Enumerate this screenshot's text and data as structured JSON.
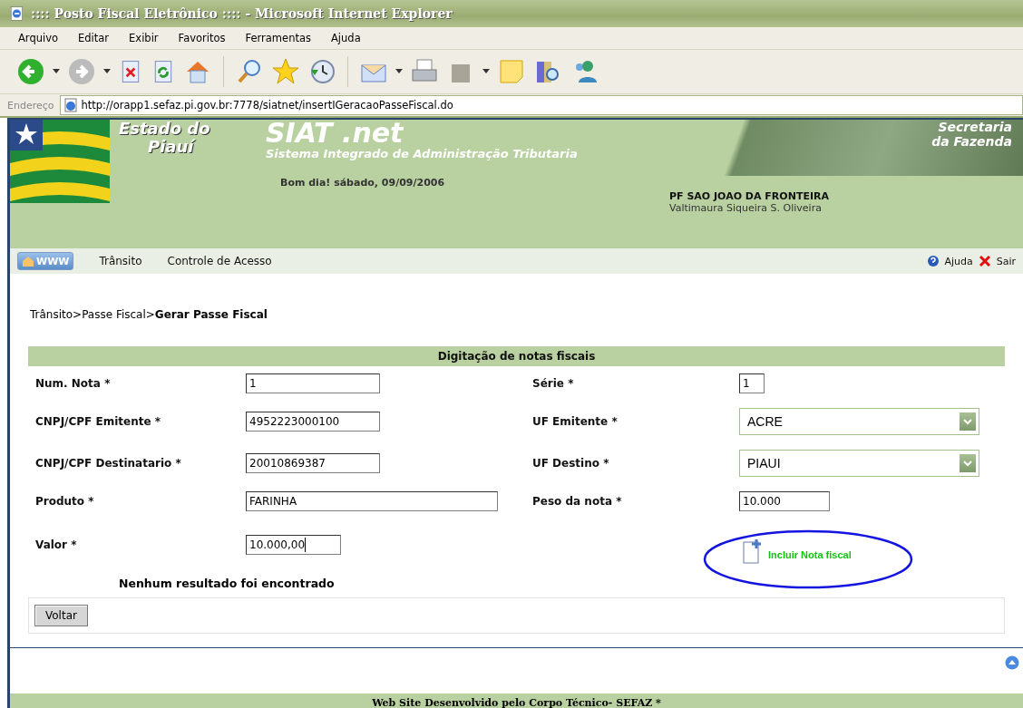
{
  "window": {
    "title": ":::: Posto Fiscal Eletrônico :::: - Microsoft Internet Explorer"
  },
  "menu": [
    "Arquivo",
    "Editar",
    "Exibir",
    "Favoritos",
    "Ferramentas",
    "Ajuda"
  ],
  "address": {
    "label": "Endereço",
    "url": "http://orapp1.sefaz.pi.gov.br:7778/siatnet/insertIGeracaoPasseFiscal.do"
  },
  "banner": {
    "state_line_1": "Estado do",
    "state_line_2": "Piauí",
    "system": "SIAT .net",
    "system_subtitle": "Sistema Integrado de Administração Tributaria",
    "greeting": "Bom dia! sábado, 09/09/2006",
    "secretariat_line_1": "Secretaria",
    "secretariat_line_2": "da Fazenda",
    "post": "PF SAO JOAO DA FRONTEIRA",
    "user": "Valtimaura Siqueira S. Oliveira"
  },
  "nav": {
    "home": "WWW",
    "items": [
      "Trânsito",
      "Controle de Acesso"
    ],
    "help": "Ajuda",
    "exit": "Sair"
  },
  "breadcrumb": "Trânsito>Passe Fiscal>**Gerar Passe Fiscal**",
  "form": {
    "title": "Digitação de notas fiscais",
    "rows": [
      {
        "left": {
          "label": "Num. Nota *",
          "kind": "medium",
          "value": "1"
        },
        "right": {
          "label": "Série *",
          "kind": "tiny",
          "value": "1"
        }
      },
      {
        "left": {
          "label": "CNPJ/CPF Emitente *",
          "kind": "medium",
          "value": "4952223000100"
        },
        "right": {
          "label": "UF Emitente *",
          "kind": "select",
          "value": "ACRE"
        }
      },
      {
        "left": {
          "label": "CNPJ/CPF Destinatario *",
          "kind": "medium",
          "value": "20010869387"
        },
        "right": {
          "label": "UF Destino *",
          "kind": "select",
          "value": "PIAUI"
        }
      },
      {
        "left": {
          "label": "Produto *",
          "kind": "long",
          "value": "FARINHA"
        },
        "right": {
          "label": "Peso da nota *",
          "kind": "short",
          "value": "10.000"
        }
      },
      {
        "left": {
          "label": "Valor *",
          "kind": "short",
          "value": "10.000,00",
          "focused": true
        }
      }
    ],
    "add_link": "Incluir Nota fiscal",
    "empty_message": "Nenhum resultado foi encontrado",
    "back_button": "Voltar"
  },
  "footer": "Web Site Desenvolvido pelo Corpo Técnico- SEFAZ *"
}
